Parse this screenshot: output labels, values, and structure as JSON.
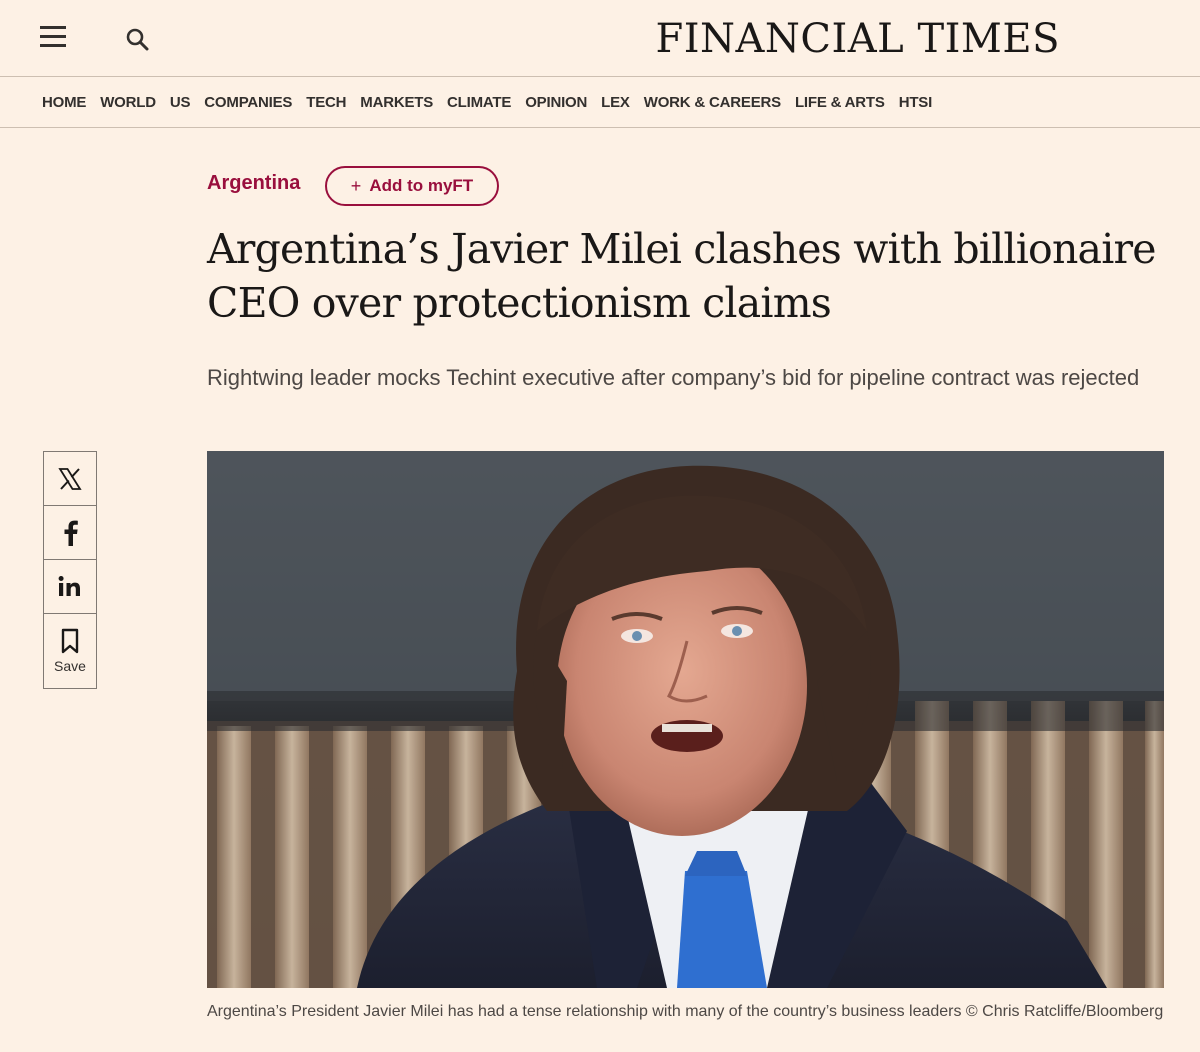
{
  "header": {
    "brand": "FINANCIAL TIMES",
    "menu_icon": "hamburger-menu-icon",
    "search_icon": "search-icon"
  },
  "nav": {
    "items": [
      "HOME",
      "WORLD",
      "US",
      "COMPANIES",
      "TECH",
      "MARKETS",
      "CLIMATE",
      "OPINION",
      "LEX",
      "WORK & CAREERS",
      "LIFE & ARTS",
      "HTSI"
    ]
  },
  "article": {
    "topic": "Argentina",
    "follow_label": "Add to myFT",
    "headline": "Argentina’s Javier Milei clashes with billionaire CEO over protectionism claims",
    "standfirst": "Rightwing leader mocks Techint executive after company’s bid for pipeline contract was rejected",
    "caption": "Argentina’s President Javier Milei has had a tense relationship with many of the country’s business leaders © Chris Ratcliffe/Bloomberg"
  },
  "share": {
    "x_icon": "x-twitter-icon",
    "facebook_icon": "facebook-icon",
    "linkedin_icon": "linkedin-icon",
    "save_icon": "bookmark-icon",
    "save_label": "Save"
  },
  "colors": {
    "background": "#fdf1e5",
    "accent": "#990f3d",
    "text": "#33302e"
  }
}
